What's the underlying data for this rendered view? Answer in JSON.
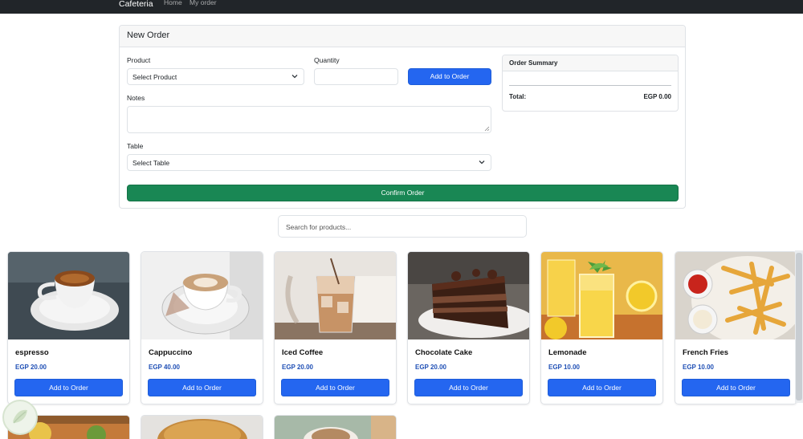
{
  "nav": {
    "brand": "Cafeteria",
    "links": [
      "Home",
      "My order"
    ]
  },
  "order_form": {
    "title": "New Order",
    "product_label": "Product",
    "product_select_value": "Select Product",
    "quantity_label": "Quantity",
    "quantity_value": "",
    "add_button_label": "Add to Order",
    "notes_label": "Notes",
    "notes_value": "",
    "table_label": "Table",
    "table_select_value": "Select Table",
    "confirm_button_label": "Confirm Order"
  },
  "order_summary": {
    "title": "Order Summary",
    "total_label": "Total:",
    "total_value": "EGP 0.00"
  },
  "search": {
    "placeholder": "Search for products..."
  },
  "products": [
    {
      "name": "espresso",
      "price": "EGP 20.00",
      "button_label": "Add to Order"
    },
    {
      "name": "Cappuccino",
      "price": "EGP 40.00",
      "button_label": "Add to Order"
    },
    {
      "name": "Iced Coffee",
      "price": "EGP 20.00",
      "button_label": "Add to Order"
    },
    {
      "name": "Chocolate Cake",
      "price": "EGP 20.00",
      "button_label": "Add to Order"
    },
    {
      "name": "Lemonade",
      "price": "EGP 10.00",
      "button_label": "Add to Order"
    },
    {
      "name": "French Fries",
      "price": "EGP 10.00",
      "button_label": "Add to Order"
    }
  ],
  "colors": {
    "navbar": "#212529",
    "primary": "#2466f0",
    "success": "#198754",
    "price": "#1f4fb5"
  },
  "icons": [
    "chevron-down-icon",
    "resize-handle-icon"
  ]
}
